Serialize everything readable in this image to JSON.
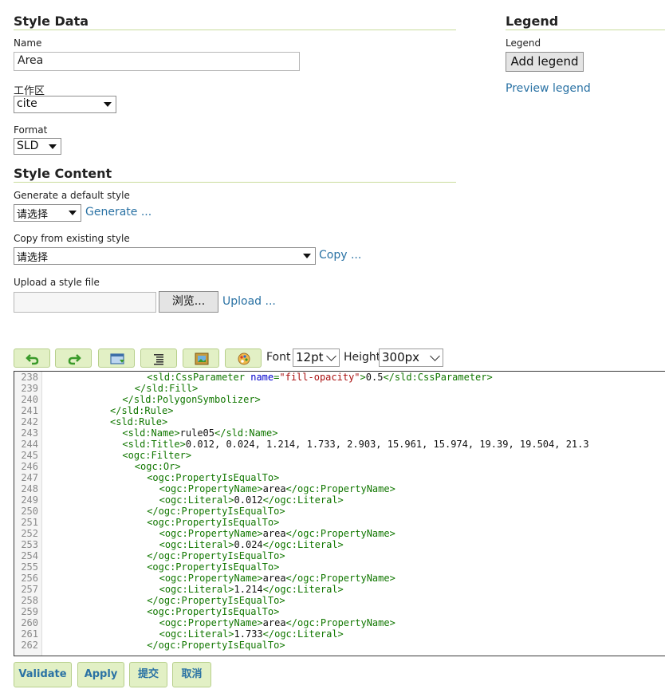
{
  "style_data": {
    "heading": "Style Data",
    "name_label": "Name",
    "name_value": "Area",
    "workspace_label": "工作区",
    "workspace_value": "cite",
    "format_label": "Format",
    "format_value": "SLD"
  },
  "legend": {
    "heading": "Legend",
    "label": "Legend",
    "add_button": "Add legend",
    "preview_link": "Preview legend"
  },
  "style_content": {
    "heading": "Style Content",
    "generate_label": "Generate a default style",
    "generate_select": "请选择",
    "generate_link": "Generate ...",
    "copy_label": "Copy from existing style",
    "copy_select": "请选择",
    "copy_link": "Copy ...",
    "upload_label": "Upload a style file",
    "upload_value": "",
    "browse_button": "浏览...",
    "upload_link": "Upload ..."
  },
  "toolbar": {
    "icons": [
      "undo-icon",
      "redo-icon",
      "go-to-line-icon",
      "reformat-icon",
      "insert-image-icon",
      "color-picker-icon"
    ],
    "font_label": "Font",
    "font_value": "12pt",
    "height_label": "Height",
    "height_value": "300px"
  },
  "colors": {
    "tag": "#117700",
    "attribute": "#0000cc",
    "string": "#aa1111",
    "text": "#111111",
    "button_bg": "#e2f0c5",
    "link": "#2a72a4"
  },
  "editor": {
    "lines": [
      {
        "n": "238",
        "indent": 16,
        "tokens": [
          [
            "tag",
            "<sld:CssParameter "
          ],
          [
            "attr",
            "name"
          ],
          [
            "tag",
            "="
          ],
          [
            "str",
            "\"fill-opacity\""
          ],
          [
            "tag",
            ">"
          ],
          [
            "text",
            "0.5"
          ],
          [
            "tag",
            "</sld:CssParameter>"
          ]
        ]
      },
      {
        "n": "239",
        "indent": 14,
        "tokens": [
          [
            "tag",
            "</sld:Fill>"
          ]
        ]
      },
      {
        "n": "240",
        "indent": 12,
        "tokens": [
          [
            "tag",
            "</sld:PolygonSymbolizer>"
          ]
        ]
      },
      {
        "n": "241",
        "indent": 10,
        "tokens": [
          [
            "tag",
            "</sld:Rule>"
          ]
        ]
      },
      {
        "n": "242",
        "indent": 10,
        "tokens": [
          [
            "tag",
            "<sld:Rule>"
          ]
        ]
      },
      {
        "n": "243",
        "indent": 12,
        "tokens": [
          [
            "tag",
            "<sld:Name>"
          ],
          [
            "text",
            "rule05"
          ],
          [
            "tag",
            "</sld:Name>"
          ]
        ]
      },
      {
        "n": "244",
        "indent": 12,
        "tokens": [
          [
            "tag",
            "<sld:Title>"
          ],
          [
            "text",
            "0.012, 0.024, 1.214, 1.733, 2.903, 15.961, 15.974, 19.39, 19.504, 21.3"
          ]
        ]
      },
      {
        "n": "245",
        "indent": 12,
        "tokens": [
          [
            "tag",
            "<ogc:Filter>"
          ]
        ]
      },
      {
        "n": "246",
        "indent": 14,
        "tokens": [
          [
            "tag",
            "<ogc:Or>"
          ]
        ]
      },
      {
        "n": "247",
        "indent": 16,
        "tokens": [
          [
            "tag",
            "<ogc:PropertyIsEqualTo>"
          ]
        ]
      },
      {
        "n": "248",
        "indent": 18,
        "tokens": [
          [
            "tag",
            "<ogc:PropertyName>"
          ],
          [
            "text",
            "area"
          ],
          [
            "tag",
            "</ogc:PropertyName>"
          ]
        ]
      },
      {
        "n": "249",
        "indent": 18,
        "tokens": [
          [
            "tag",
            "<ogc:Literal>"
          ],
          [
            "text",
            "0.012"
          ],
          [
            "tag",
            "</ogc:Literal>"
          ]
        ]
      },
      {
        "n": "250",
        "indent": 16,
        "tokens": [
          [
            "tag",
            "</ogc:PropertyIsEqualTo>"
          ]
        ]
      },
      {
        "n": "251",
        "indent": 16,
        "tokens": [
          [
            "tag",
            "<ogc:PropertyIsEqualTo>"
          ]
        ]
      },
      {
        "n": "252",
        "indent": 18,
        "tokens": [
          [
            "tag",
            "<ogc:PropertyName>"
          ],
          [
            "text",
            "area"
          ],
          [
            "tag",
            "</ogc:PropertyName>"
          ]
        ]
      },
      {
        "n": "253",
        "indent": 18,
        "tokens": [
          [
            "tag",
            "<ogc:Literal>"
          ],
          [
            "text",
            "0.024"
          ],
          [
            "tag",
            "</ogc:Literal>"
          ]
        ]
      },
      {
        "n": "254",
        "indent": 16,
        "tokens": [
          [
            "tag",
            "</ogc:PropertyIsEqualTo>"
          ]
        ]
      },
      {
        "n": "255",
        "indent": 16,
        "tokens": [
          [
            "tag",
            "<ogc:PropertyIsEqualTo>"
          ]
        ]
      },
      {
        "n": "256",
        "indent": 18,
        "tokens": [
          [
            "tag",
            "<ogc:PropertyName>"
          ],
          [
            "text",
            "area"
          ],
          [
            "tag",
            "</ogc:PropertyName>"
          ]
        ]
      },
      {
        "n": "257",
        "indent": 18,
        "tokens": [
          [
            "tag",
            "<ogc:Literal>"
          ],
          [
            "text",
            "1.214"
          ],
          [
            "tag",
            "</ogc:Literal>"
          ]
        ]
      },
      {
        "n": "258",
        "indent": 16,
        "tokens": [
          [
            "tag",
            "</ogc:PropertyIsEqualTo>"
          ]
        ]
      },
      {
        "n": "259",
        "indent": 16,
        "tokens": [
          [
            "tag",
            "<ogc:PropertyIsEqualTo>"
          ]
        ]
      },
      {
        "n": "260",
        "indent": 18,
        "tokens": [
          [
            "tag",
            "<ogc:PropertyName>"
          ],
          [
            "text",
            "area"
          ],
          [
            "tag",
            "</ogc:PropertyName>"
          ]
        ]
      },
      {
        "n": "261",
        "indent": 18,
        "tokens": [
          [
            "tag",
            "<ogc:Literal>"
          ],
          [
            "text",
            "1.733"
          ],
          [
            "tag",
            "</ogc:Literal>"
          ]
        ]
      },
      {
        "n": "262",
        "indent": 16,
        "tokens": [
          [
            "tag",
            "</ogc:PropertyIsEqualTo>"
          ]
        ]
      }
    ]
  },
  "actions": {
    "validate": "Validate",
    "apply": "Apply",
    "submit": "提交",
    "cancel": "取消"
  }
}
